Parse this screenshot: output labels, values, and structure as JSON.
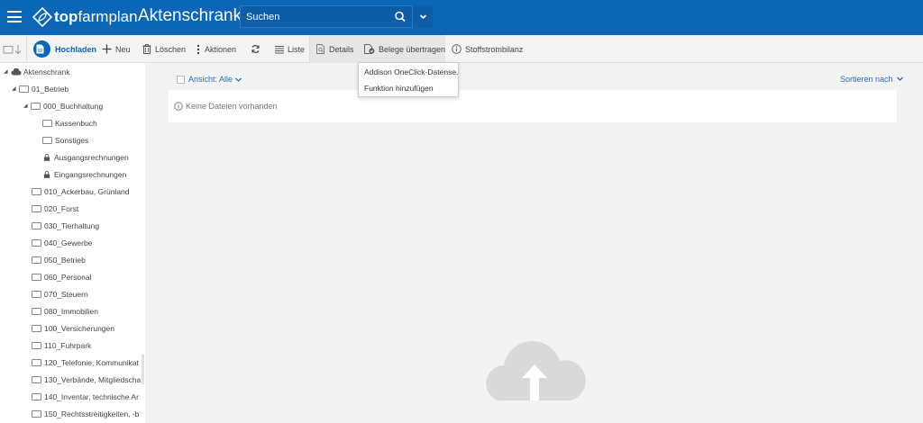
{
  "header": {
    "brand_bold": "top",
    "brand_regular": "farmplan",
    "app_title": "Aktenschrank",
    "search_placeholder": "Suchen"
  },
  "toolbar": {
    "upload": "Hochladen",
    "new": "Neu",
    "delete": "Löschen",
    "actions": "Aktionen",
    "list": "Liste",
    "details": "Details",
    "transfer": "Belege übertragen",
    "stoffstrom": "Stoffstrombilanz"
  },
  "dropdown": {
    "items": [
      "Addison OneClick-Datense...",
      "Funktion hinzufügen"
    ]
  },
  "tree": {
    "root": "Aktenschrank",
    "betrieb": "01_Betrieb",
    "buchhaltung": "000_Buchhaltung",
    "kassenbuch": "Kassenbuch",
    "sonstiges": "Sonstiges",
    "ausgang": "Ausgangsrechnungen",
    "eingang": "Eingangsrechnungen",
    "folders": [
      "010_Ackerbau, Grünland",
      "020_Forst",
      "030_Tierhaltung",
      "040_Gewerbe",
      "050_Betrieb",
      "060_Personal",
      "070_Steuern",
      "080_Immobilien",
      "100_Versicherungen",
      "110_Fuhrpark",
      "120_Telefonie, Kommunikat",
      "130_Verbände, Mitgliedscha",
      "140_Inventar, technische Ar",
      "150_Rechtsstreitigkeiten, -b"
    ]
  },
  "main": {
    "view_label": "Ansicht: Alle",
    "sort_label": "Sortieren nach",
    "empty_text": "Keine Dateien vorhanden"
  },
  "colors": {
    "brand_blue": "#0a66b7",
    "link_blue": "#2a6fb6"
  }
}
